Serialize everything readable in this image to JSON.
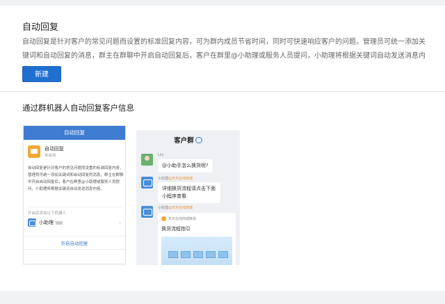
{
  "header": {
    "title": "自动回复",
    "description": "自动回复是针对客户的常见问题而设置的标准回复内容，可为群内成员节省时间，同时可快速响应客户的问题。管理员可统一添加关键词和自动回复的消息，群主在群聊中开启自动回复后，客户在群里@小助理或服务人员提问，小助理将根据关键词自动发送消息内容。",
    "new_button": "新建"
  },
  "section": {
    "subtitle": "通过群机器人自动回复客户信息"
  },
  "left_phone": {
    "header": "自动回复",
    "app_name": "自动回复",
    "app_state": "未启用",
    "description": "自动回复是针对客户的常见问题而设置的标准回复内容，管理员可统一添加关键词和自动回复的消息，群主在群聊中开启自动回复后，客户在群里@小助理或服务人员提问，小助理将根据关键词自动发送消息内容。",
    "section_label": "开启后添加以下机器人",
    "bot_name": "小助理",
    "footer_button": "开启自动回复"
  },
  "right_phone": {
    "title": "客户群",
    "messages": [
      {
        "sender": "Lily",
        "text": "@小助手怎么换货呢?"
      },
      {
        "sender": "小助理",
        "tag": "@天天在线商城",
        "text": "详细换货流程请点击下面小程序查看"
      },
      {
        "sender": "小助理",
        "tag": "@天天在线商城",
        "card_source": "天天在线商城换货",
        "card_title": "换货流程指引"
      }
    ]
  }
}
